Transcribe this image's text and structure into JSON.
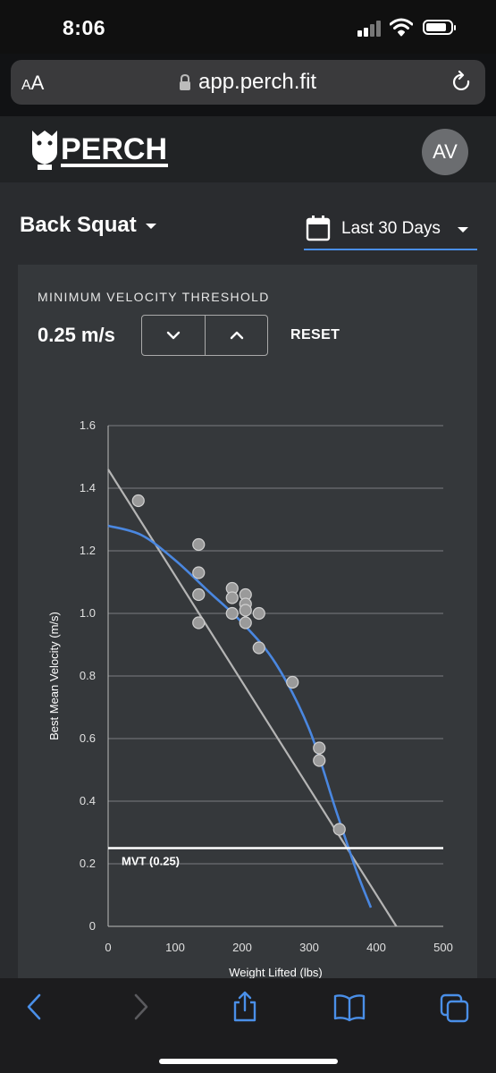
{
  "status_bar": {
    "time": "8:06"
  },
  "browser": {
    "text_size_label": "AA",
    "url": "app.perch.fit"
  },
  "app": {
    "logo_text": "PERCH",
    "avatar_initials": "AV"
  },
  "controls": {
    "exercise": "Back Squat",
    "date_range": "Last 30 Days",
    "mvt_title": "MINIMUM VELOCITY THRESHOLD",
    "mvt_value": "0.25 m/s",
    "reset_label": "RESET"
  },
  "colors": {
    "fit_curve": "#4a87e0",
    "linear_fit": "#b5b5b5",
    "points": "#9a9a9a",
    "mvt_line": "#ffffff",
    "accent": "#4a8fe8"
  },
  "chart_data": {
    "type": "scatter",
    "xlabel": "Weight Lifted (lbs)",
    "ylabel": "Best Mean Velocity (m/s)",
    "xlim": [
      0,
      500
    ],
    "ylim": [
      0,
      1.6
    ],
    "x_ticks": [
      0,
      100,
      200,
      300,
      400,
      500
    ],
    "y_ticks": [
      0,
      0.2,
      0.4,
      0.6,
      0.8,
      1.0,
      1.2,
      1.4,
      1.6
    ],
    "grid": true,
    "points": [
      {
        "x": 45,
        "y": 1.36
      },
      {
        "x": 135,
        "y": 1.22
      },
      {
        "x": 135,
        "y": 1.13
      },
      {
        "x": 135,
        "y": 1.06
      },
      {
        "x": 135,
        "y": 0.97
      },
      {
        "x": 185,
        "y": 1.08
      },
      {
        "x": 185,
        "y": 1.05
      },
      {
        "x": 185,
        "y": 1.0
      },
      {
        "x": 205,
        "y": 1.06
      },
      {
        "x": 205,
        "y": 1.03
      },
      {
        "x": 205,
        "y": 1.01
      },
      {
        "x": 205,
        "y": 0.97
      },
      {
        "x": 225,
        "y": 1.0
      },
      {
        "x": 225,
        "y": 0.89
      },
      {
        "x": 275,
        "y": 0.78
      },
      {
        "x": 315,
        "y": 0.57
      },
      {
        "x": 315,
        "y": 0.53
      },
      {
        "x": 345,
        "y": 0.31
      }
    ],
    "linear_fit": [
      {
        "x": 0,
        "y": 1.46
      },
      {
        "x": 430,
        "y": 0
      }
    ],
    "curve_fit": [
      {
        "x": 0,
        "y": 1.28
      },
      {
        "x": 50,
        "y": 1.25
      },
      {
        "x": 100,
        "y": 1.17
      },
      {
        "x": 150,
        "y": 1.07
      },
      {
        "x": 200,
        "y": 0.97
      },
      {
        "x": 250,
        "y": 0.84
      },
      {
        "x": 300,
        "y": 0.63
      },
      {
        "x": 340,
        "y": 0.37
      },
      {
        "x": 370,
        "y": 0.18
      },
      {
        "x": 392,
        "y": 0.06
      }
    ],
    "threshold": {
      "y": 0.25,
      "label": "MVT (0.25)"
    }
  }
}
